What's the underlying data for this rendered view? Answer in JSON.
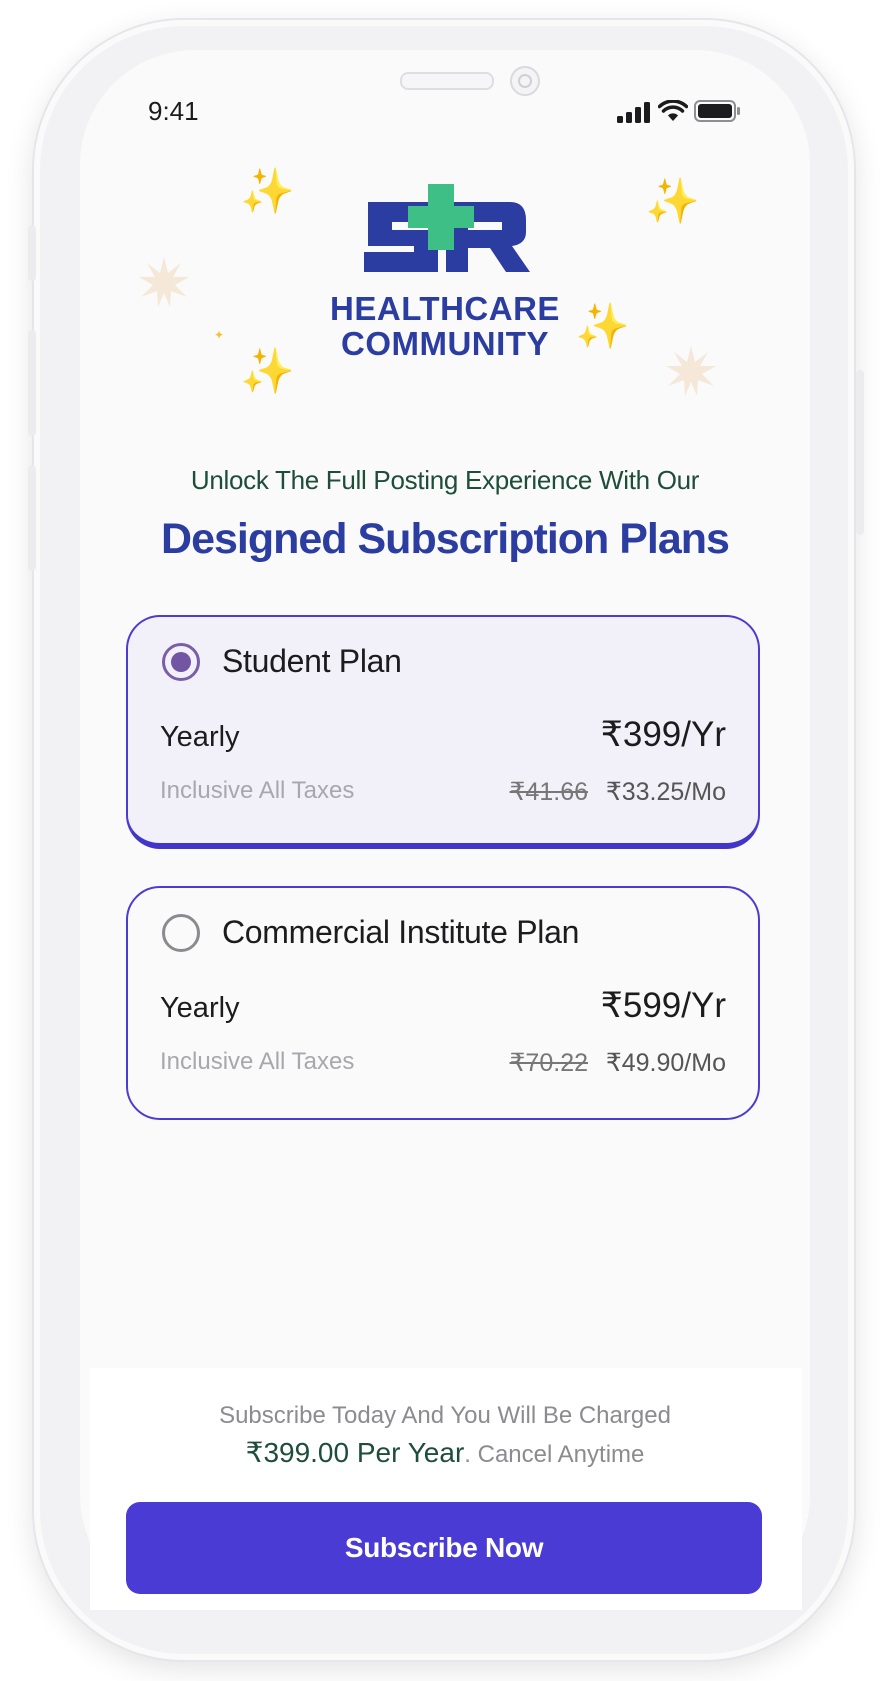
{
  "status_bar": {
    "time": "9:41"
  },
  "brand": {
    "logo_letters": "SR",
    "line1": "HEALTHCARE",
    "line2": "COMMUNITY",
    "colors": {
      "navy": "#2b3da0",
      "green": "#3dbf85"
    }
  },
  "header": {
    "subtitle": "Unlock The Full Posting Experience With Our",
    "headline": "Designed Subscription Plans"
  },
  "plans": [
    {
      "name": "Student Plan",
      "selected": true,
      "period": "Yearly",
      "price": "₹399/Yr",
      "taxes_note": "Inclusive All Taxes",
      "old_monthly": "₹41.66",
      "monthly": "₹33.25/Mo"
    },
    {
      "name": "Commercial Institute Plan",
      "selected": false,
      "period": "Yearly",
      "price": "₹599/Yr",
      "taxes_note": "Inclusive All Taxes",
      "old_monthly": "₹70.22",
      "monthly": "₹49.90/Mo"
    }
  ],
  "footer": {
    "line1": "Subscribe Today And You Will Be Charged",
    "amount": "₹399.00 Per Year",
    "suffix": ". Cancel Anytime",
    "button_label": "Subscribe Now"
  },
  "accent_color": "#4a3bd4"
}
